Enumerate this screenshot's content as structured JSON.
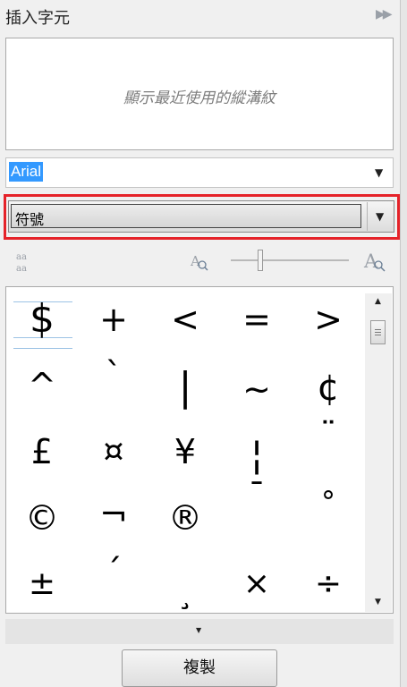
{
  "panel": {
    "title": "插入字元",
    "collapse_icon": "double-chevron-right-icon"
  },
  "recent": {
    "placeholder": "顯示最近使用的縱溝紋"
  },
  "font": {
    "value": "Arial"
  },
  "category": {
    "value": "符號"
  },
  "toolbar": {
    "glyph_options_icon": "aa-icon",
    "zoom_out_icon": "small-a-zoom-icon",
    "zoom_in_icon": "large-a-zoom-icon",
    "zoom_level": 0.25
  },
  "glyphs": [
    [
      "$",
      "+",
      "<",
      "=",
      ">"
    ],
    [
      "^",
      "`",
      "|",
      "~",
      "¢"
    ],
    [
      "£",
      "¤",
      "¥",
      "¦",
      "¨"
    ],
    [
      "©",
      "¬",
      "®",
      "¯",
      "°"
    ],
    [
      "±",
      "´",
      "¸",
      "×",
      "÷"
    ]
  ],
  "actions": {
    "copy_label": "複製"
  },
  "colors": {
    "highlight": "#e52229",
    "selection": "#3399ff"
  }
}
